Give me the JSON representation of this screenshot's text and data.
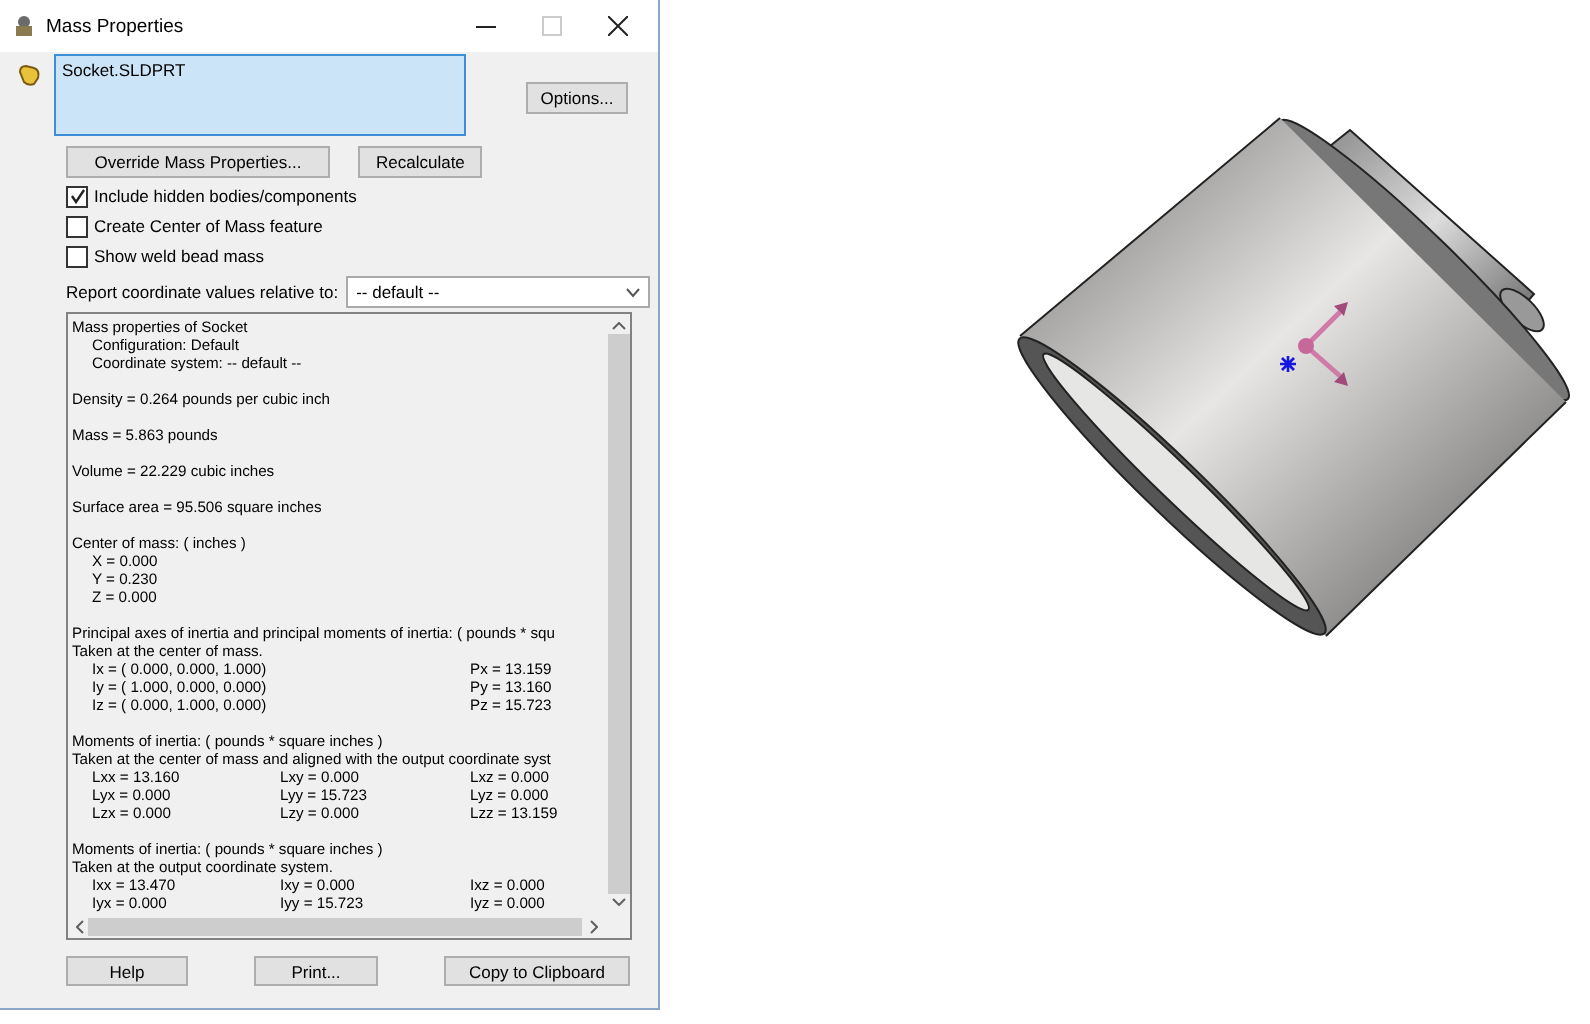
{
  "window": {
    "title": "Mass Properties"
  },
  "selection": {
    "items": [
      "Socket.SLDPRT"
    ]
  },
  "buttons_top": {
    "options": "Options...",
    "override": "Override Mass Properties...",
    "recalculate": "Recalculate"
  },
  "checkboxes": [
    {
      "label": "Include hidden bodies/components",
      "checked": true
    },
    {
      "label": "Create Center of Mass feature",
      "checked": false
    },
    {
      "label": "Show weld bead mass",
      "checked": false
    }
  ],
  "coordinate_select": {
    "label": "Report coordinate values relative to:",
    "value": "-- default --"
  },
  "report": [
    {
      "lines": [
        {
          "indented": false,
          "cells": [
            "Mass properties of Socket"
          ]
        },
        {
          "indented": true,
          "cells": [
            "Configuration: Default"
          ]
        },
        {
          "indented": true,
          "cells": [
            "Coordinate system: -- default --"
          ]
        }
      ]
    },
    {
      "lines": [
        {
          "indented": false,
          "cells": [
            "Density = 0.264 pounds per cubic inch"
          ]
        }
      ]
    },
    {
      "lines": [
        {
          "indented": false,
          "cells": [
            "Mass = 5.863 pounds"
          ]
        }
      ]
    },
    {
      "lines": [
        {
          "indented": false,
          "cells": [
            "Volume = 22.229 cubic inches"
          ]
        }
      ]
    },
    {
      "lines": [
        {
          "indented": false,
          "cells": [
            "Surface area = 95.506 square inches"
          ]
        }
      ]
    },
    {
      "lines": [
        {
          "indented": false,
          "cells": [
            "Center of mass: ( inches )"
          ]
        },
        {
          "indented": true,
          "cells": [
            "X = 0.000"
          ]
        },
        {
          "indented": true,
          "cells": [
            "Y = 0.230"
          ]
        },
        {
          "indented": true,
          "cells": [
            "Z = 0.000"
          ]
        }
      ]
    },
    {
      "lines": [
        {
          "indented": false,
          "cells": [
            "Principal axes of inertia and principal moments of inertia: ( pounds * squ"
          ]
        },
        {
          "indented": false,
          "cells": [
            "Taken at the center of mass."
          ]
        },
        {
          "indented": true,
          "cells": [
            "Ix = ( 0.000,  0.000,  1.000)",
            "",
            "Px = 13.159"
          ]
        },
        {
          "indented": true,
          "cells": [
            "Iy = ( 1.000,  0.000,  0.000)",
            "",
            "Py = 13.160"
          ]
        },
        {
          "indented": true,
          "cells": [
            "Iz = ( 0.000,  1.000,  0.000)",
            "",
            "Pz = 15.723"
          ]
        }
      ]
    },
    {
      "lines": [
        {
          "indented": false,
          "cells": [
            "Moments of inertia: ( pounds * square inches )"
          ]
        },
        {
          "indented": false,
          "cells": [
            "Taken at the center of mass and aligned with the output coordinate syst"
          ]
        },
        {
          "indented": true,
          "cells": [
            "Lxx = 13.160",
            "Lxy = 0.000",
            "Lxz = 0.000"
          ]
        },
        {
          "indented": true,
          "cells": [
            "Lyx = 0.000",
            "Lyy = 15.723",
            "Lyz = 0.000"
          ]
        },
        {
          "indented": true,
          "cells": [
            "Lzx = 0.000",
            "Lzy = 0.000",
            "Lzz = 13.159"
          ]
        }
      ]
    },
    {
      "lines": [
        {
          "indented": false,
          "cells": [
            "Moments of inertia: ( pounds * square inches )"
          ]
        },
        {
          "indented": false,
          "cells": [
            "Taken at the output coordinate system."
          ]
        },
        {
          "indented": true,
          "cells": [
            "Ixx = 13.470",
            "Ixy = 0.000",
            "Ixz = 0.000"
          ]
        },
        {
          "indented": true,
          "cells": [
            "Iyx = 0.000",
            "Iyy = 15.723",
            "Iyz = 0.000"
          ]
        }
      ]
    }
  ],
  "buttons_bottom": [
    "Help",
    "Print...",
    "Copy to Clipboard"
  ]
}
